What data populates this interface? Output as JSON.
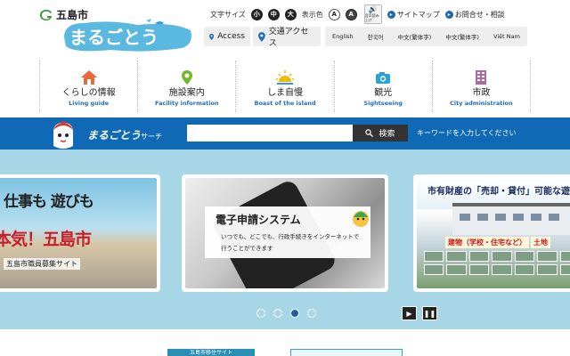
{
  "header": {
    "city_name": "五島市",
    "brand": "まるごとう"
  },
  "utility": {
    "font_size_label": "文字サイズ",
    "sizes": [
      "小",
      "中",
      "大"
    ],
    "color_label": "表示色",
    "color_options": [
      "A",
      "A"
    ],
    "read_aloud": "音声読み上げ",
    "sitemap": "サイトマップ",
    "contact": "お問合せ・相談"
  },
  "access": {
    "access_label": "Access",
    "transport_label": "交通アクセス"
  },
  "languages": [
    "English",
    "한국어",
    "中文(繁体字)",
    "中文(繁体字)",
    "Việt Nam"
  ],
  "nav": [
    {
      "ja": "くらしの情報",
      "en": "Living guide",
      "icon": "house-icon",
      "color": "#e86a3c"
    },
    {
      "ja": "施設案内",
      "en": "Facility information",
      "icon": "map-pin-icon",
      "color": "#76b82a"
    },
    {
      "ja": "しま自慢",
      "en": "Boast of the island",
      "icon": "sunrise-icon",
      "color": "#f2b800"
    },
    {
      "ja": "観光",
      "en": "Sightseeing",
      "icon": "camera-icon",
      "color": "#2aa0d6"
    },
    {
      "ja": "市政",
      "en": "City administration",
      "icon": "building-icon",
      "color": "#b06aa8"
    }
  ],
  "search": {
    "title_main": "まるごとう",
    "title_small": "サーチ",
    "placeholder": "",
    "button_label": "検索",
    "hint": "キーワードを入力してください"
  },
  "slides": {
    "s1": {
      "line1": "仕事も 遊びも",
      "line2": "本気！五島市",
      "line3": "五島市職員募集サイト"
    },
    "s2": {
      "title": "電子申請システム",
      "sub": "いつでも、どこでも、行政手続きをインターネットで行うことができます"
    },
    "s3": {
      "title": "市有財産の「売却・貸付」可能な遊",
      "tag1": "建物（学校・住宅など）",
      "tag2": "土地"
    }
  },
  "carousel": {
    "current_page": 3,
    "page_count": 4
  },
  "bottom": {
    "banner_left": "五島市移住サイト"
  },
  "colors": {
    "primary_blue": "#0f69b4",
    "carousel_bg": "#a7d6e6",
    "accent_en": "#1f6fb8"
  }
}
